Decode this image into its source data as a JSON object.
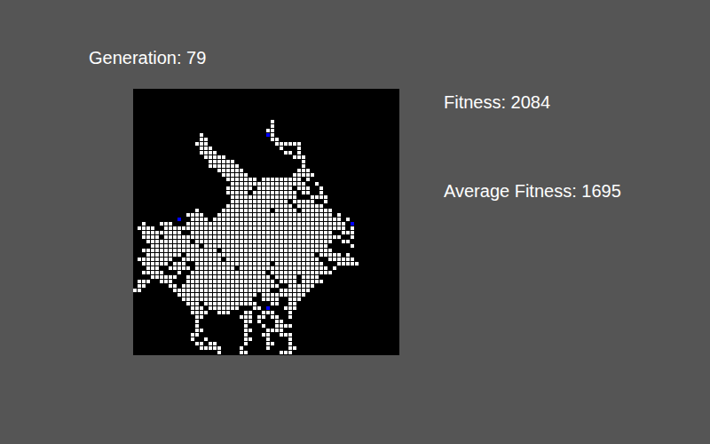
{
  "generation": "Generation: 79",
  "fitness": "Fitness: 2084",
  "average_fitness": "Average Fitness: 1695",
  "grid": {
    "rows": [
      [],
      [],
      [],
      [],
      [],
      [],
      [],
      [
        [
          31,
          31
        ]
      ],
      [
        [
          31,
          31
        ]
      ],
      [
        [
          30,
          31
        ]
      ],
      [
        [
          15,
          15
        ],
        [
          31,
          31
        ]
      ],
      [
        [
          15,
          16
        ],
        [
          31,
          32
        ]
      ],
      [
        [
          14,
          16
        ],
        [
          32,
          37
        ]
      ],
      [
        [
          15,
          17
        ],
        [
          33,
          33
        ],
        [
          37,
          37
        ]
      ],
      [
        [
          15,
          18
        ],
        [
          34,
          35
        ],
        [
          37,
          37
        ]
      ],
      [
        [
          16,
          20
        ],
        [
          36,
          38
        ]
      ],
      [
        [
          17,
          22
        ],
        [
          38,
          38
        ]
      ],
      [
        [
          17,
          23
        ],
        [
          38,
          38
        ]
      ],
      [
        [
          19,
          24
        ],
        [
          37,
          39
        ]
      ],
      [
        [
          20,
          25
        ],
        [
          36,
          40
        ]
      ],
      [
        [
          21,
          27
        ],
        [
          29,
          37
        ],
        [
          39,
          39
        ]
      ],
      [
        [
          22,
          38
        ],
        [
          41,
          41
        ]
      ],
      [
        [
          21,
          26
        ],
        [
          28,
          35
        ],
        [
          37,
          39
        ],
        [
          42,
          42
        ]
      ],
      [
        [
          21,
          25
        ],
        [
          27,
          36
        ],
        [
          38,
          39
        ],
        [
          42,
          42
        ]
      ],
      [
        [
          22,
          36
        ],
        [
          40,
          43
        ]
      ],
      [
        [
          22,
          34
        ],
        [
          36,
          40
        ],
        [
          43,
          43
        ]
      ],
      [
        [
          21,
          35
        ],
        [
          37,
          42
        ]
      ],
      [
        [
          14,
          14
        ],
        [
          20,
          30
        ],
        [
          32,
          36
        ],
        [
          38,
          44
        ]
      ],
      [
        [
          12,
          15
        ],
        [
          19,
          44
        ],
        [
          46,
          46
        ]
      ],
      [
        [
          13,
          16
        ],
        [
          18,
          46
        ],
        [
          48,
          48
        ]
      ],
      [
        [
          2,
          2
        ],
        [
          6,
          8
        ],
        [
          12,
          47
        ]
      ],
      [
        [
          1,
          4
        ],
        [
          7,
          47
        ],
        [
          49,
          49
        ]
      ],
      [
        [
          2,
          10
        ],
        [
          13,
          44
        ],
        [
          47,
          49
        ]
      ],
      [
        [
          2,
          5
        ],
        [
          7,
          46
        ],
        [
          49,
          49
        ]
      ],
      [
        [
          3,
          12
        ],
        [
          14,
          44
        ],
        [
          47,
          48
        ]
      ],
      [
        [
          4,
          14
        ],
        [
          16,
          43
        ],
        [
          49,
          49
        ]
      ],
      [
        [
          2,
          18
        ],
        [
          20,
          44
        ]
      ],
      [
        [
          3,
          10
        ],
        [
          12,
          40
        ],
        [
          42,
          46
        ],
        [
          48,
          48
        ]
      ],
      [
        [
          1,
          8
        ],
        [
          11,
          19
        ],
        [
          21,
          41
        ],
        [
          44,
          49
        ]
      ],
      [
        [
          2,
          7
        ],
        [
          9,
          11
        ],
        [
          14,
          30
        ],
        [
          32,
          42
        ],
        [
          46,
          50
        ]
      ],
      [
        [
          3,
          5
        ],
        [
          8,
          12
        ],
        [
          14,
          22
        ],
        [
          24,
          43
        ],
        [
          45,
          45
        ]
      ],
      [
        [
          2,
          6
        ],
        [
          10,
          10
        ],
        [
          13,
          29
        ],
        [
          31,
          44
        ]
      ],
      [
        [
          4,
          9
        ],
        [
          12,
          30
        ],
        [
          32,
          36
        ],
        [
          38,
          41
        ]
      ],
      [
        [
          1,
          3
        ],
        [
          6,
          8
        ],
        [
          12,
          31
        ],
        [
          33,
          36
        ],
        [
          38,
          42
        ]
      ],
      [
        [
          1,
          2
        ],
        [
          8,
          9
        ],
        [
          11,
          32
        ],
        [
          35,
          40
        ]
      ],
      [
        [
          0,
          1
        ],
        [
          9,
          30
        ],
        [
          33,
          39
        ]
      ],
      [
        [
          10,
          27
        ],
        [
          29,
          38
        ]
      ],
      [
        [
          11,
          26
        ],
        [
          29,
          32
        ],
        [
          35,
          37
        ]
      ],
      [
        [
          12,
          14
        ],
        [
          16,
          27
        ],
        [
          31,
          32
        ],
        [
          35,
          36
        ]
      ],
      [
        [
          13,
          15
        ],
        [
          17,
          23
        ],
        [
          27,
          28
        ],
        [
          34,
          36
        ]
      ],
      [
        [
          13,
          16
        ],
        [
          19,
          21
        ],
        [
          25,
          26
        ],
        [
          29,
          31
        ],
        [
          35,
          35
        ]
      ],
      [
        [
          14,
          15
        ],
        [
          24,
          26
        ],
        [
          28,
          29
        ],
        [
          31,
          32
        ],
        [
          35,
          35
        ]
      ],
      [
        [
          14,
          14
        ],
        [
          25,
          26
        ],
        [
          28,
          28
        ],
        [
          32,
          33
        ]
      ],
      [
        [
          14,
          14
        ],
        [
          25,
          25
        ],
        [
          29,
          29
        ],
        [
          32,
          35
        ]
      ],
      [
        [
          14,
          15
        ],
        [
          25,
          26
        ],
        [
          30,
          33
        ]
      ],
      [
        [
          13,
          14
        ],
        [
          25,
          25
        ],
        [
          29,
          30
        ],
        [
          33,
          35
        ]
      ],
      [
        [
          13,
          13
        ],
        [
          16,
          16
        ],
        [
          25,
          26
        ],
        [
          30,
          30
        ],
        [
          35,
          35
        ]
      ],
      [
        [
          14,
          15
        ],
        [
          17,
          18
        ],
        [
          25,
          25
        ],
        [
          30,
          31
        ],
        [
          35,
          35
        ]
      ],
      [
        [
          15,
          19
        ],
        [
          24,
          24
        ],
        [
          30,
          30
        ],
        [
          35,
          36
        ]
      ],
      [
        [
          19,
          19
        ],
        [
          24,
          25
        ],
        [
          33,
          35
        ]
      ]
    ],
    "marked": [
      [
        10,
        30
      ],
      [
        29,
        10
      ],
      [
        30,
        49
      ],
      [
        49,
        30
      ]
    ]
  }
}
